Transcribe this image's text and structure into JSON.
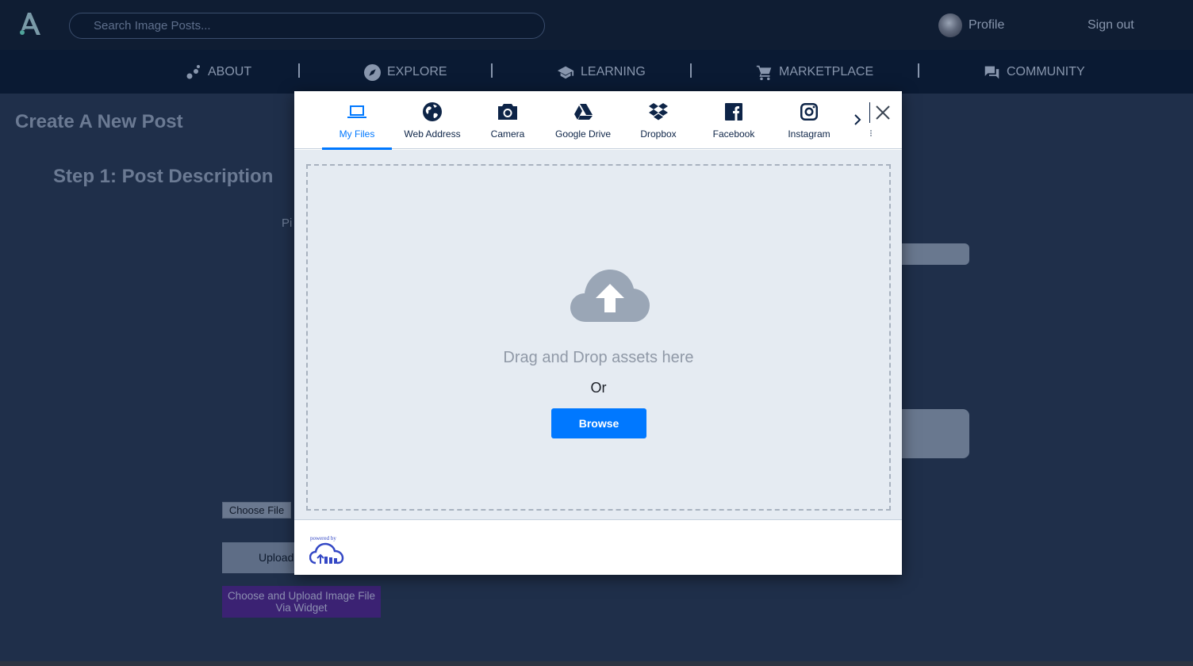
{
  "header": {
    "search_placeholder": "Search Image Posts...",
    "profile_label": "Profile",
    "signout_label": "Sign out"
  },
  "nav": {
    "items": [
      {
        "label": "ABOUT",
        "icon": "dots-icon"
      },
      {
        "label": "EXPLORE",
        "icon": "compass-icon"
      },
      {
        "label": "LEARNING",
        "icon": "graduation-cap-icon"
      },
      {
        "label": "MARKETPLACE",
        "icon": "cart-icon"
      },
      {
        "label": "COMMUNITY",
        "icon": "chat-icon"
      }
    ]
  },
  "page": {
    "title": "Create A New Post",
    "step_title": "Step 1: Post Description",
    "partial_label": "Pi",
    "choose_file_label": "Choose File",
    "upload_label": "Upload",
    "widget_button_label": "Choose and Upload Image File Via Widget"
  },
  "widget": {
    "tabs": [
      {
        "label": "My Files",
        "icon": "laptop-icon",
        "active": true
      },
      {
        "label": "Web Address",
        "icon": "globe-icon",
        "active": false
      },
      {
        "label": "Camera",
        "icon": "camera-icon",
        "active": false
      },
      {
        "label": "Google Drive",
        "icon": "google-drive-icon",
        "active": false
      },
      {
        "label": "Dropbox",
        "icon": "dropbox-icon",
        "active": false
      },
      {
        "label": "Facebook",
        "icon": "facebook-icon",
        "active": false
      },
      {
        "label": "Instagram",
        "icon": "instagram-icon",
        "active": false
      }
    ],
    "drag_text": "Drag and Drop assets here",
    "or_text": "Or",
    "browse_label": "Browse",
    "powered_by": "powered by"
  },
  "colors": {
    "accent": "#0078ff",
    "page_bg": "#1f2f4a",
    "topbar_bg": "#0f1d33",
    "navbar_bg": "#0a1a33",
    "widget_button_bg": "#3b2273"
  }
}
